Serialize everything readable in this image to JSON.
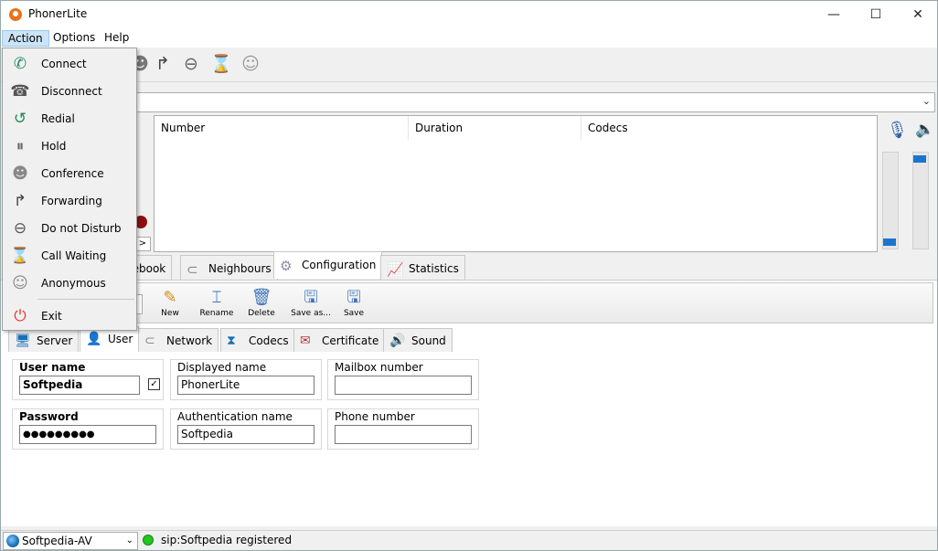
{
  "window": {
    "title": "PhonerLite",
    "minimize": "—",
    "maximize": "☐",
    "close": "✕"
  },
  "menubar": {
    "action": "Action",
    "options": "Options",
    "help": "Help"
  },
  "action_menu": {
    "items": [
      {
        "label": "Connect",
        "icon": "phone-icon",
        "glyph": "✆",
        "color": "#1f8a5a"
      },
      {
        "label": "Disconnect",
        "icon": "hangup-icon",
        "glyph": "☎",
        "color": "#555555"
      },
      {
        "label": "Redial",
        "icon": "redial-icon",
        "glyph": "↺",
        "color": "#1f8a5a"
      },
      {
        "label": "Hold",
        "icon": "hold-icon",
        "glyph": "⏸",
        "color": "#666666"
      },
      {
        "label": "Conference",
        "icon": "conference-icon",
        "glyph": "☻",
        "color": "#888888"
      },
      {
        "label": "Forwarding",
        "icon": "forward-icon",
        "glyph": "↱",
        "color": "#444444"
      },
      {
        "label": "Do not Disturb",
        "icon": "dnd-icon",
        "glyph": "⊖",
        "color": "#555555"
      },
      {
        "label": "Call Waiting",
        "icon": "call-waiting-icon",
        "glyph": "⌛",
        "color": "#1f8a5a"
      },
      {
        "label": "Anonymous",
        "icon": "anonymous-icon",
        "glyph": "☺",
        "color": "#888888"
      }
    ],
    "exit": {
      "label": "Exit",
      "icon": "power-icon",
      "glyph": "⏻",
      "color": "#e03a2f"
    }
  },
  "calls_table": {
    "columns": [
      "Number",
      "Duration",
      "Codecs"
    ]
  },
  "main_tabs": {
    "phonebook": "nebook",
    "neighbours": "Neighbours",
    "configuration": "Configuration",
    "statistics": "Statistics"
  },
  "config_toolbar": {
    "new": "New",
    "rename": "Rename",
    "delete": "Delete",
    "save_as": "Save as...",
    "save": "Save"
  },
  "config_tabs": {
    "server": "Server",
    "user": "User",
    "network": "Network",
    "codecs": "Codecs",
    "certificate": "Certificate",
    "sound": "Sound"
  },
  "user_form": {
    "user_name_label": "User name",
    "user_name_value": "Softpedia",
    "user_name_checked": "✓",
    "displayed_name_label": "Displayed name",
    "displayed_name_value": "PhonerLite",
    "mailbox_label": "Mailbox number",
    "mailbox_value": "",
    "password_label": "Password",
    "password_value": "●●●●●●●●●",
    "auth_name_label": "Authentication name",
    "auth_name_value": "Softpedia",
    "phone_number_label": "Phone number",
    "phone_number_value": ""
  },
  "statusbar": {
    "profile": "Softpedia-AV",
    "status": "sip:Softpedia registered"
  },
  "colors": {
    "accent": "#1b75d0",
    "status_ok": "#22c522",
    "menu_highlight": "#cce4f7"
  }
}
